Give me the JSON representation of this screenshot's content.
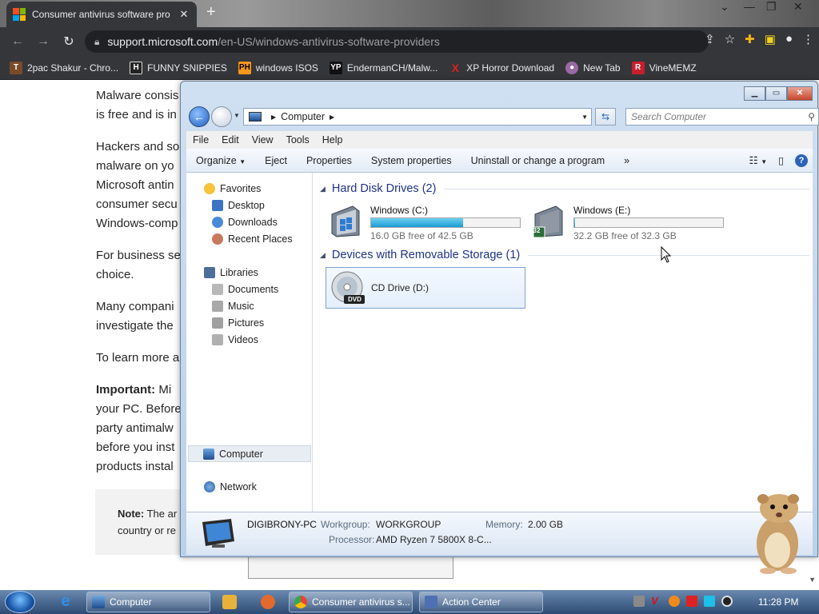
{
  "browser": {
    "tab_title": "Consumer antivirus software pro",
    "tab_close": "✕",
    "new_tab": "+",
    "url_domain": "support.microsoft.com",
    "url_path": "/en-US/windows-antivirus-software-providers",
    "bookmarks": [
      {
        "label": "2pac Shakur - Chro...",
        "icon": "T",
        "color": "#7a4b2a"
      },
      {
        "label": "FUNNY SNIPPIES",
        "icon": "H",
        "color": "#222222"
      },
      {
        "label": "windows ISOS",
        "icon": "PH",
        "color": "#f7971d"
      },
      {
        "label": "EndermanCH/Malw...",
        "icon": "YP",
        "color": "#111111"
      },
      {
        "label": "XP Horror Download",
        "icon": "X",
        "color": "#d01010"
      },
      {
        "label": "New Tab",
        "icon": "●",
        "color": "#9a6aa5"
      },
      {
        "label": "VineMEMZ",
        "icon": "R",
        "color": "#c81e2d"
      }
    ]
  },
  "webpage": {
    "lines": [
      "Malware consis",
      "is free and is in",
      "Hackers and so",
      "malware on yo",
      "Microsoft antin",
      "consumer secu",
      "Windows-comp",
      "For business se",
      "choice.",
      "Many compani",
      "investigate the",
      "To learn more a",
      "Important: Mi",
      "your PC. Before",
      "party antimalw",
      "before you inst",
      "products instal"
    ],
    "important_label": "Important:",
    "note_label": "Note:",
    "note_lines": [
      "The ar",
      "country or re"
    ]
  },
  "explorer": {
    "address": {
      "location": "Computer"
    },
    "search_placeholder": "Search Computer",
    "menu": [
      "File",
      "Edit",
      "View",
      "Tools",
      "Help"
    ],
    "commands": [
      "Organize",
      "Eject",
      "Properties",
      "System properties",
      "Uninstall or change a program",
      "»"
    ],
    "nav": {
      "favorites": "Favorites",
      "desktop": "Desktop",
      "downloads": "Downloads",
      "recent": "Recent Places",
      "libraries": "Libraries",
      "documents": "Documents",
      "music": "Music",
      "pictures": "Pictures",
      "videos": "Videos",
      "computer": "Computer",
      "network": "Network"
    },
    "groups": {
      "hdd": "Hard Disk Drives (2)",
      "removable": "Devices with Removable Storage (1)"
    },
    "drives": [
      {
        "name": "Windows (C:)",
        "free": "16.0 GB free of 42.5 GB",
        "used_fraction": 0.62
      },
      {
        "name": "Windows (E:)",
        "free": "32.2 GB free of 32.3 GB",
        "used_fraction": 0.003,
        "badge": "32"
      }
    ],
    "cd": {
      "name": "CD Drive (D:)",
      "label": "DVD"
    },
    "details": {
      "pc_name": "DIGIBRONY-PC",
      "workgroup_label": "Workgroup:",
      "workgroup": "WORKGROUP",
      "memory_label": "Memory:",
      "memory": "2.00 GB",
      "processor_label": "Processor:",
      "processor": "AMD Ryzen 7 5800X 8-C..."
    }
  },
  "taskbar": {
    "buttons": [
      "Computer",
      "Consumer antivirus s...",
      "Action Center"
    ],
    "clock": "11:28 PM"
  },
  "colors": {
    "chrome_dark": "#35363a",
    "drive_fill": "#1b9ad4",
    "group_header": "#1e3287",
    "taskbar": "#2c4a73"
  }
}
